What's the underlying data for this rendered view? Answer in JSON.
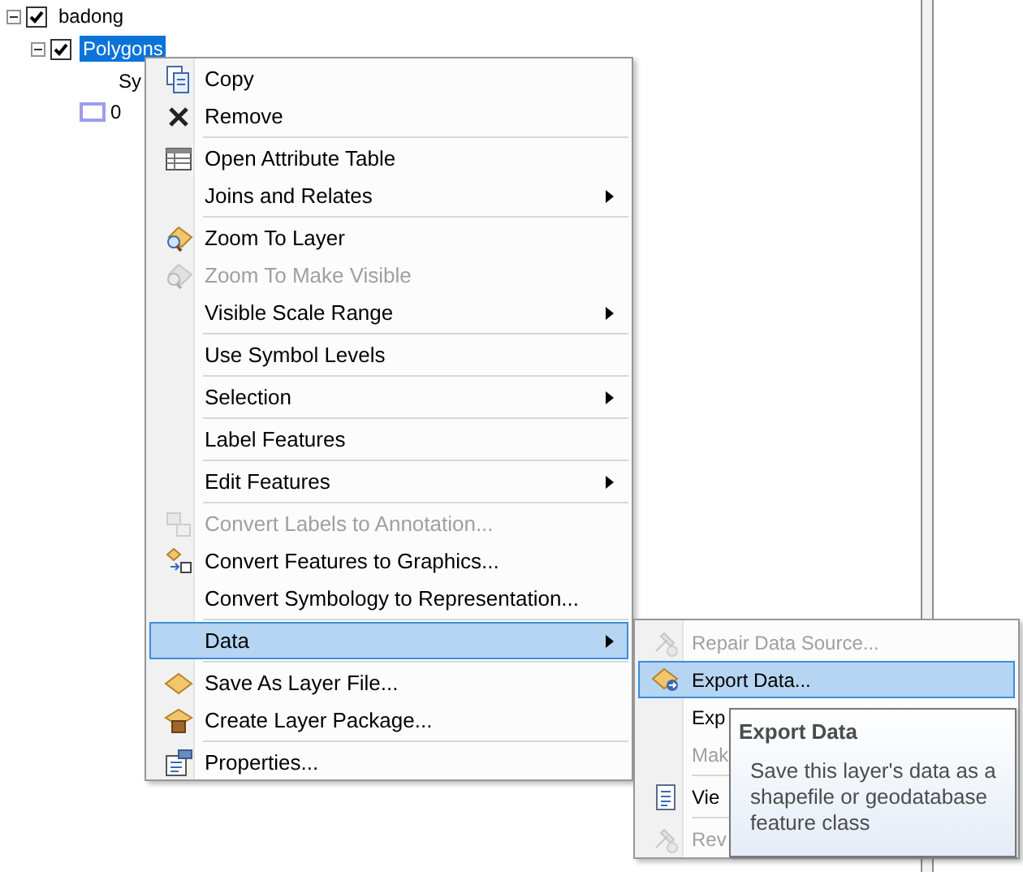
{
  "toc": {
    "layers": [
      {
        "label": "badong",
        "checked": true,
        "expanded": true,
        "selected": false,
        "children": [
          {
            "label": "Polygons",
            "checked": true,
            "expanded": true,
            "selected": true,
            "legend_heading": "Sy",
            "legend_classes": [
              {
                "label": "0",
                "color": "#9c9cf0"
              }
            ]
          }
        ]
      }
    ]
  },
  "context_menu": {
    "items": [
      {
        "kind": "item",
        "label": "Copy",
        "disabled": false,
        "submenu": false,
        "selected": false
      },
      {
        "kind": "item",
        "label": "Remove",
        "disabled": false,
        "submenu": false,
        "selected": false
      },
      {
        "kind": "separator"
      },
      {
        "kind": "item",
        "label": "Open Attribute Table",
        "disabled": false,
        "submenu": false,
        "selected": false
      },
      {
        "kind": "item",
        "label": "Joins and Relates",
        "disabled": false,
        "submenu": true,
        "selected": false
      },
      {
        "kind": "separator"
      },
      {
        "kind": "item",
        "label": "Zoom To Layer",
        "disabled": false,
        "submenu": false,
        "selected": false
      },
      {
        "kind": "item",
        "label": "Zoom To Make Visible",
        "disabled": true,
        "submenu": false,
        "selected": false
      },
      {
        "kind": "item",
        "label": "Visible Scale Range",
        "disabled": false,
        "submenu": true,
        "selected": false
      },
      {
        "kind": "separator"
      },
      {
        "kind": "item",
        "label": "Use Symbol Levels",
        "disabled": false,
        "submenu": false,
        "selected": false
      },
      {
        "kind": "separator"
      },
      {
        "kind": "item",
        "label": "Selection",
        "disabled": false,
        "submenu": true,
        "selected": false
      },
      {
        "kind": "separator"
      },
      {
        "kind": "item",
        "label": "Label Features",
        "disabled": false,
        "submenu": false,
        "selected": false
      },
      {
        "kind": "separator"
      },
      {
        "kind": "item",
        "label": "Edit Features",
        "disabled": false,
        "submenu": true,
        "selected": false
      },
      {
        "kind": "separator"
      },
      {
        "kind": "item",
        "label": "Convert Labels to Annotation...",
        "disabled": true,
        "submenu": false,
        "selected": false
      },
      {
        "kind": "item",
        "label": "Convert Features to Graphics...",
        "disabled": false,
        "submenu": false,
        "selected": false
      },
      {
        "kind": "item",
        "label": "Convert Symbology to Representation...",
        "disabled": false,
        "submenu": false,
        "selected": false
      },
      {
        "kind": "separator"
      },
      {
        "kind": "item",
        "label": "Data",
        "disabled": false,
        "submenu": true,
        "selected": true
      },
      {
        "kind": "separator"
      },
      {
        "kind": "item",
        "label": "Save As Layer File...",
        "disabled": false,
        "submenu": false,
        "selected": false
      },
      {
        "kind": "item",
        "label": "Create Layer Package...",
        "disabled": false,
        "submenu": false,
        "selected": false
      },
      {
        "kind": "separator"
      },
      {
        "kind": "item",
        "label": "Properties...",
        "disabled": false,
        "submenu": false,
        "selected": false
      }
    ]
  },
  "data_submenu": {
    "items": [
      {
        "kind": "item",
        "label": "Repair Data Source...",
        "disabled": true,
        "selected": false
      },
      {
        "kind": "item",
        "label": "Export Data...",
        "disabled": false,
        "selected": true
      },
      {
        "kind": "item",
        "label": "Exp",
        "disabled": false,
        "selected": false
      },
      {
        "kind": "item",
        "label": "Mak",
        "disabled": true,
        "selected": false
      },
      {
        "kind": "separator"
      },
      {
        "kind": "item",
        "label": "Vie",
        "disabled": false,
        "selected": false
      },
      {
        "kind": "separator"
      },
      {
        "kind": "item",
        "label": "Rev",
        "disabled": true,
        "selected": false
      }
    ]
  },
  "tooltip": {
    "title": "Export Data",
    "text": "Save this layer's data as a shapefile or geodatabase feature class"
  }
}
